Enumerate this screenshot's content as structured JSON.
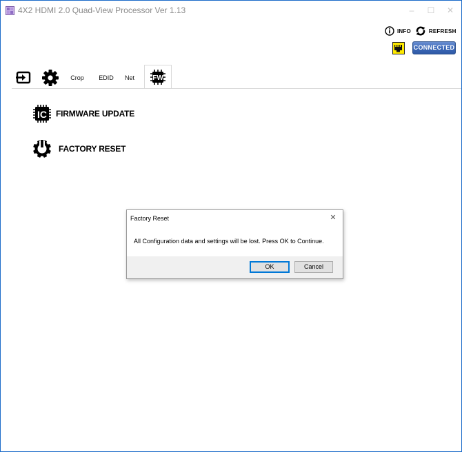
{
  "window": {
    "title": "4X2 HDMI 2.0 Quad-View Processor  Ver 1.13",
    "minimize": "–",
    "maximize": "☐",
    "close": "✕"
  },
  "header": {
    "info_label": "INFO",
    "refresh_label": "REFRESH",
    "connection_status": "CONNECTED",
    "network_icon": "ethernet-port-icon",
    "status_color": "#3d69b8",
    "badge_color": "#ffea00"
  },
  "tabs": [
    {
      "id": "input",
      "icon": "input-icon",
      "label": ""
    },
    {
      "id": "settings",
      "icon": "gear-icon",
      "label": ""
    },
    {
      "id": "crop",
      "label": "Crop"
    },
    {
      "id": "edid",
      "label": "EDID"
    },
    {
      "id": "net",
      "label": "Net"
    },
    {
      "id": "fw",
      "icon": "fw-icon",
      "label": "FW",
      "active": true
    }
  ],
  "main": {
    "firmware_update_label": "FIRMWARE UPDATE",
    "factory_reset_label": "FACTORY RESET"
  },
  "dialog": {
    "title": "Factory Reset",
    "message": "All Configuration data and settings will be lost. Press OK to Continue.",
    "ok_label": "OK",
    "cancel_label": "Cancel",
    "close_glyph": "✕"
  }
}
